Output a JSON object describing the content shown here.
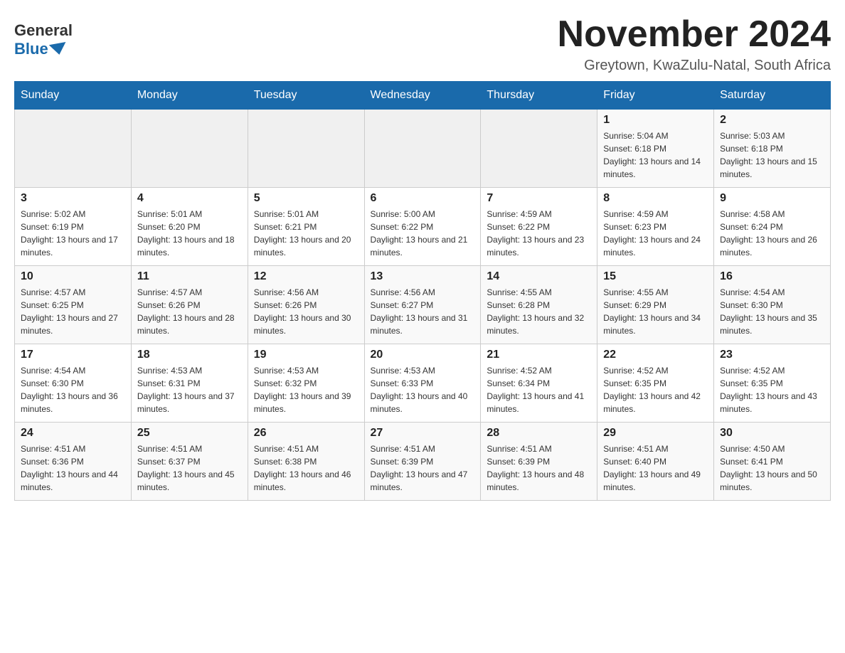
{
  "header": {
    "logo_general": "General",
    "logo_blue": "Blue",
    "month_title": "November 2024",
    "location": "Greytown, KwaZulu-Natal, South Africa"
  },
  "days_of_week": [
    "Sunday",
    "Monday",
    "Tuesday",
    "Wednesday",
    "Thursday",
    "Friday",
    "Saturday"
  ],
  "weeks": [
    {
      "days": [
        {
          "num": "",
          "sunrise": "",
          "sunset": "",
          "daylight": ""
        },
        {
          "num": "",
          "sunrise": "",
          "sunset": "",
          "daylight": ""
        },
        {
          "num": "",
          "sunrise": "",
          "sunset": "",
          "daylight": ""
        },
        {
          "num": "",
          "sunrise": "",
          "sunset": "",
          "daylight": ""
        },
        {
          "num": "",
          "sunrise": "",
          "sunset": "",
          "daylight": ""
        },
        {
          "num": "1",
          "sunrise": "Sunrise: 5:04 AM",
          "sunset": "Sunset: 6:18 PM",
          "daylight": "Daylight: 13 hours and 14 minutes."
        },
        {
          "num": "2",
          "sunrise": "Sunrise: 5:03 AM",
          "sunset": "Sunset: 6:18 PM",
          "daylight": "Daylight: 13 hours and 15 minutes."
        }
      ]
    },
    {
      "days": [
        {
          "num": "3",
          "sunrise": "Sunrise: 5:02 AM",
          "sunset": "Sunset: 6:19 PM",
          "daylight": "Daylight: 13 hours and 17 minutes."
        },
        {
          "num": "4",
          "sunrise": "Sunrise: 5:01 AM",
          "sunset": "Sunset: 6:20 PM",
          "daylight": "Daylight: 13 hours and 18 minutes."
        },
        {
          "num": "5",
          "sunrise": "Sunrise: 5:01 AM",
          "sunset": "Sunset: 6:21 PM",
          "daylight": "Daylight: 13 hours and 20 minutes."
        },
        {
          "num": "6",
          "sunrise": "Sunrise: 5:00 AM",
          "sunset": "Sunset: 6:22 PM",
          "daylight": "Daylight: 13 hours and 21 minutes."
        },
        {
          "num": "7",
          "sunrise": "Sunrise: 4:59 AM",
          "sunset": "Sunset: 6:22 PM",
          "daylight": "Daylight: 13 hours and 23 minutes."
        },
        {
          "num": "8",
          "sunrise": "Sunrise: 4:59 AM",
          "sunset": "Sunset: 6:23 PM",
          "daylight": "Daylight: 13 hours and 24 minutes."
        },
        {
          "num": "9",
          "sunrise": "Sunrise: 4:58 AM",
          "sunset": "Sunset: 6:24 PM",
          "daylight": "Daylight: 13 hours and 26 minutes."
        }
      ]
    },
    {
      "days": [
        {
          "num": "10",
          "sunrise": "Sunrise: 4:57 AM",
          "sunset": "Sunset: 6:25 PM",
          "daylight": "Daylight: 13 hours and 27 minutes."
        },
        {
          "num": "11",
          "sunrise": "Sunrise: 4:57 AM",
          "sunset": "Sunset: 6:26 PM",
          "daylight": "Daylight: 13 hours and 28 minutes."
        },
        {
          "num": "12",
          "sunrise": "Sunrise: 4:56 AM",
          "sunset": "Sunset: 6:26 PM",
          "daylight": "Daylight: 13 hours and 30 minutes."
        },
        {
          "num": "13",
          "sunrise": "Sunrise: 4:56 AM",
          "sunset": "Sunset: 6:27 PM",
          "daylight": "Daylight: 13 hours and 31 minutes."
        },
        {
          "num": "14",
          "sunrise": "Sunrise: 4:55 AM",
          "sunset": "Sunset: 6:28 PM",
          "daylight": "Daylight: 13 hours and 32 minutes."
        },
        {
          "num": "15",
          "sunrise": "Sunrise: 4:55 AM",
          "sunset": "Sunset: 6:29 PM",
          "daylight": "Daylight: 13 hours and 34 minutes."
        },
        {
          "num": "16",
          "sunrise": "Sunrise: 4:54 AM",
          "sunset": "Sunset: 6:30 PM",
          "daylight": "Daylight: 13 hours and 35 minutes."
        }
      ]
    },
    {
      "days": [
        {
          "num": "17",
          "sunrise": "Sunrise: 4:54 AM",
          "sunset": "Sunset: 6:30 PM",
          "daylight": "Daylight: 13 hours and 36 minutes."
        },
        {
          "num": "18",
          "sunrise": "Sunrise: 4:53 AM",
          "sunset": "Sunset: 6:31 PM",
          "daylight": "Daylight: 13 hours and 37 minutes."
        },
        {
          "num": "19",
          "sunrise": "Sunrise: 4:53 AM",
          "sunset": "Sunset: 6:32 PM",
          "daylight": "Daylight: 13 hours and 39 minutes."
        },
        {
          "num": "20",
          "sunrise": "Sunrise: 4:53 AM",
          "sunset": "Sunset: 6:33 PM",
          "daylight": "Daylight: 13 hours and 40 minutes."
        },
        {
          "num": "21",
          "sunrise": "Sunrise: 4:52 AM",
          "sunset": "Sunset: 6:34 PM",
          "daylight": "Daylight: 13 hours and 41 minutes."
        },
        {
          "num": "22",
          "sunrise": "Sunrise: 4:52 AM",
          "sunset": "Sunset: 6:35 PM",
          "daylight": "Daylight: 13 hours and 42 minutes."
        },
        {
          "num": "23",
          "sunrise": "Sunrise: 4:52 AM",
          "sunset": "Sunset: 6:35 PM",
          "daylight": "Daylight: 13 hours and 43 minutes."
        }
      ]
    },
    {
      "days": [
        {
          "num": "24",
          "sunrise": "Sunrise: 4:51 AM",
          "sunset": "Sunset: 6:36 PM",
          "daylight": "Daylight: 13 hours and 44 minutes."
        },
        {
          "num": "25",
          "sunrise": "Sunrise: 4:51 AM",
          "sunset": "Sunset: 6:37 PM",
          "daylight": "Daylight: 13 hours and 45 minutes."
        },
        {
          "num": "26",
          "sunrise": "Sunrise: 4:51 AM",
          "sunset": "Sunset: 6:38 PM",
          "daylight": "Daylight: 13 hours and 46 minutes."
        },
        {
          "num": "27",
          "sunrise": "Sunrise: 4:51 AM",
          "sunset": "Sunset: 6:39 PM",
          "daylight": "Daylight: 13 hours and 47 minutes."
        },
        {
          "num": "28",
          "sunrise": "Sunrise: 4:51 AM",
          "sunset": "Sunset: 6:39 PM",
          "daylight": "Daylight: 13 hours and 48 minutes."
        },
        {
          "num": "29",
          "sunrise": "Sunrise: 4:51 AM",
          "sunset": "Sunset: 6:40 PM",
          "daylight": "Daylight: 13 hours and 49 minutes."
        },
        {
          "num": "30",
          "sunrise": "Sunrise: 4:50 AM",
          "sunset": "Sunset: 6:41 PM",
          "daylight": "Daylight: 13 hours and 50 minutes."
        }
      ]
    }
  ]
}
